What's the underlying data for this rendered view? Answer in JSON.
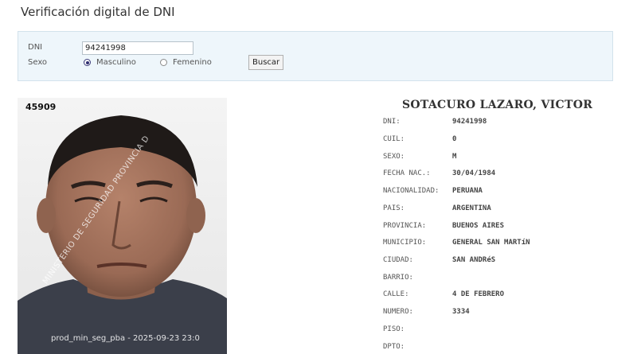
{
  "page": {
    "title": "Verificación digital de DNI"
  },
  "search": {
    "dni_label": "DNI",
    "dni_value": "94241998",
    "sexo_label": "Sexo",
    "options": [
      "Masculino",
      "Femenino"
    ],
    "selected_option": "Masculino",
    "button_label": "Buscar"
  },
  "photo": {
    "record_number": "45909",
    "watermark_diagonal": "MINISTERIO DE SEGURIDAD PROVINCIA D",
    "watermark_bottom": "prod_min_seg_pba - 2025-09-23 23:0"
  },
  "person": {
    "name": "SOTACURO LAZARO, VICTOR",
    "fields": [
      {
        "label": "DNI:",
        "value": "94241998"
      },
      {
        "label": "CUIL:",
        "value": "0"
      },
      {
        "label": "SEXO:",
        "value": "M"
      },
      {
        "label": "FECHA NAC.:",
        "value": "30/04/1984"
      },
      {
        "label": "NACIONALIDAD:",
        "value": "PERUANA"
      },
      {
        "label": "PAIS:",
        "value": "ARGENTINA"
      },
      {
        "label": "PROVINCIA:",
        "value": "BUENOS AIRES"
      },
      {
        "label": "MUNICIPIO:",
        "value": "GENERAL SAN MARTíN"
      },
      {
        "label": "CIUDAD:",
        "value": "SAN ANDRéS"
      },
      {
        "label": "BARRIO:",
        "value": ""
      },
      {
        "label": "CALLE:",
        "value": "4 DE FEBRERO"
      },
      {
        "label": "NUMERO:",
        "value": "3334"
      },
      {
        "label": "PISO:",
        "value": ""
      },
      {
        "label": "DPTO:",
        "value": ""
      }
    ]
  },
  "colors": {
    "panel_background": "#eef6fb",
    "panel_border": "#d3e2ec",
    "text": "#333333",
    "selected_radio": "#2f2f70"
  }
}
